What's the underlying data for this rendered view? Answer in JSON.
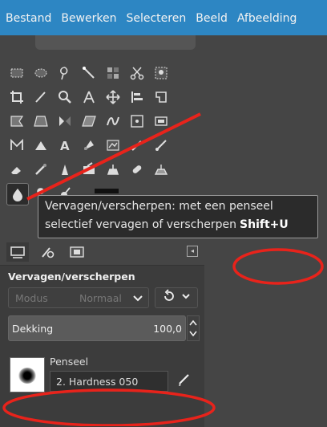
{
  "menubar": {
    "items": [
      "Bestand",
      "Bewerken",
      "Selecteren",
      "Beeld",
      "Afbeelding"
    ]
  },
  "toolbox": {
    "tools": [
      [
        "rect-select-icon",
        "ellipse-select-icon",
        "lasso-icon",
        "fuzzy-select-icon",
        "select-by-color-icon",
        "scissors-icon",
        "foreground-select-icon"
      ],
      [
        "crop-icon",
        "measure-icon",
        "zoom-icon",
        "transform-icon",
        "move-icon",
        "align-icon",
        "cage-transform-icon"
      ],
      [
        "unified-transform-icon",
        "perspective-icon",
        "flip-icon",
        "shear-icon",
        "warp-icon",
        "handle-transform-icon",
        "text-box-icon"
      ],
      [
        "path-icon",
        "bucket-fill-icon",
        "text-icon",
        "gradient-icon",
        "paint-dynamics-icon",
        "pencil-icon",
        "paintbrush-icon"
      ],
      [
        "eraser-icon",
        "airbrush-icon",
        "ink-icon",
        "mypaint-icon",
        "clone-icon",
        "heal-icon",
        "perspective-clone-icon"
      ],
      [
        "blur-sharpen-icon",
        "smudge-icon",
        "dodge-burn-icon"
      ]
    ],
    "active": "blur-sharpen-icon"
  },
  "tooltip": {
    "line1": "Vervagen/verscherpen: met een penseel",
    "line2": "selectief vervagen of verscherpen",
    "shortcut": "Shift+U"
  },
  "tool_options": {
    "title": "Vervagen/verscherpen",
    "mode_label": "Modus",
    "mode_value": "Normaal",
    "opacity_label": "Dekking",
    "opacity_value": "100,0",
    "brush_label": "Penseel",
    "brush_name": "2. Hardness 050"
  },
  "colors": {
    "accent": "#2d86c3",
    "annotation": "#e8231b",
    "panel": "#454545"
  }
}
